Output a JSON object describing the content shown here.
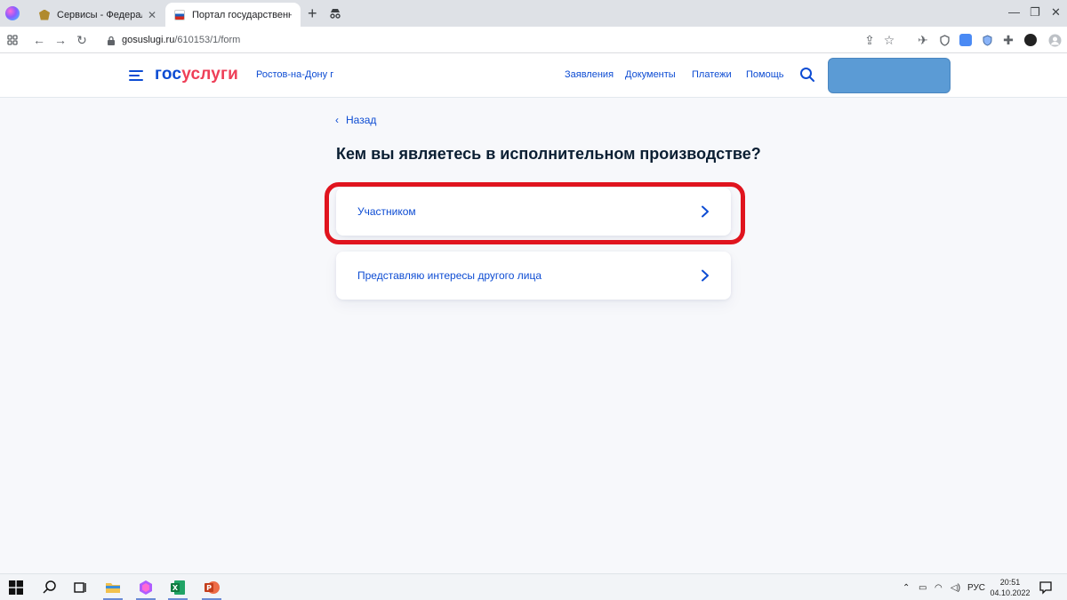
{
  "browser": {
    "tabs": [
      {
        "title": "Сервисы - Федеральная служба судебных приставов",
        "favicon": "fssp-eagle-icon"
      },
      {
        "title": "Портал государственных услуг Российской Федерации",
        "favicon": "russia-flag-icon"
      }
    ],
    "url_domain": "gosuslugi.ru",
    "url_path": "/610153/1/form"
  },
  "site": {
    "logo_part1": "гос",
    "logo_part2": "услуги",
    "region": "Ростов-на-Дону г",
    "nav": [
      "Заявления",
      "Документы",
      "Платежи",
      "Помощь"
    ]
  },
  "page": {
    "back_label": "Назад",
    "question": "Кем вы являетесь в исполнительном производстве?",
    "options": [
      "Участником",
      "Представляю интересы другого лица"
    ]
  },
  "taskbar": {
    "lang": "РУС",
    "time": "20:51",
    "date": "04.10.2022"
  },
  "colors": {
    "accent": "#0d4cd3",
    "logo_red": "#ee3f58",
    "highlight": "#e0141e",
    "account_box": "#5b9bd5"
  }
}
